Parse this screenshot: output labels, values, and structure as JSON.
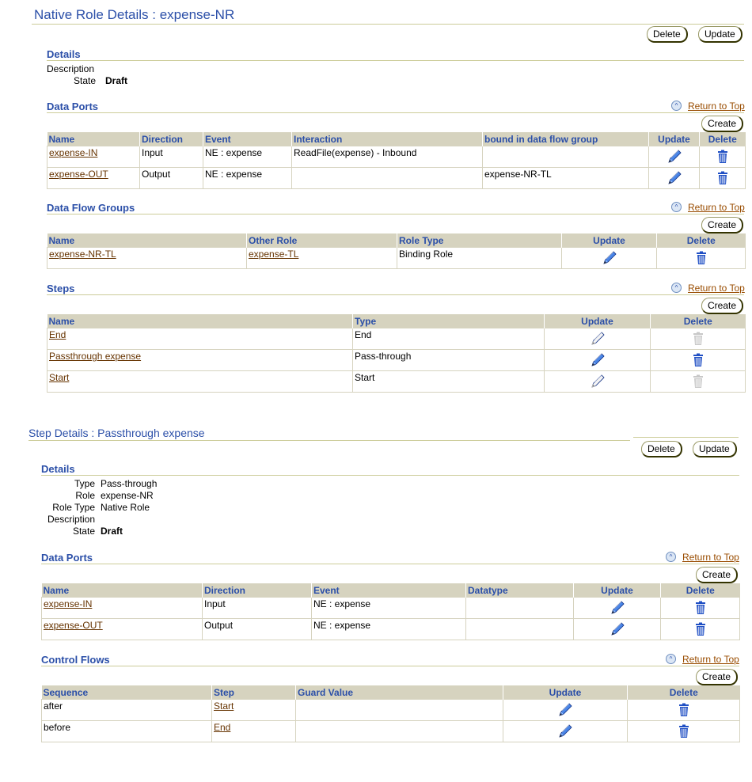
{
  "role": {
    "title": "Native Role Details : expense-NR",
    "buttons": {
      "delete": "Delete",
      "update": "Update"
    },
    "details": {
      "heading": "Details",
      "fields": [
        {
          "label": "Description",
          "value": ""
        },
        {
          "label": "State",
          "value": "Draft"
        }
      ]
    },
    "data_ports": {
      "heading": "Data Ports",
      "return_to_top": "Return to Top",
      "create": "Create",
      "columns": [
        "Name",
        "Direction",
        "Event",
        "Interaction",
        "bound in data flow group",
        "Update",
        "Delete"
      ],
      "rows": [
        {
          "name": "expense-IN",
          "direction": "Input",
          "event": "NE : expense",
          "interaction": "ReadFile(expense) - Inbound",
          "bound": "",
          "enabled": true
        },
        {
          "name": "expense-OUT",
          "direction": "Output",
          "event": "NE : expense",
          "interaction": "",
          "bound": "expense-NR-TL",
          "enabled": true
        }
      ]
    },
    "data_flow_groups": {
      "heading": "Data Flow Groups",
      "return_to_top": "Return to Top",
      "create": "Create",
      "columns": [
        "Name",
        "Other Role",
        "Role Type",
        "Update",
        "Delete"
      ],
      "rows": [
        {
          "name": "expense-NR-TL",
          "other_role": "expense-TL",
          "role_type": "Binding Role",
          "enabled": true
        }
      ]
    },
    "steps": {
      "heading": "Steps",
      "return_to_top": "Return to Top",
      "create": "Create",
      "columns": [
        "Name",
        "Type",
        "Update",
        "Delete"
      ],
      "rows": [
        {
          "name": "End",
          "type": "End",
          "enabled": false
        },
        {
          "name": "Passthrough expense",
          "type": "Pass-through",
          "enabled": true
        },
        {
          "name": "Start",
          "type": "Start",
          "enabled": false
        }
      ]
    }
  },
  "step": {
    "title": "Step Details : Passthrough expense",
    "buttons": {
      "delete": "Delete",
      "update": "Update"
    },
    "details": {
      "heading": "Details",
      "fields": [
        {
          "label": "Type",
          "value": "Pass-through"
        },
        {
          "label": "Role",
          "value": "expense-NR"
        },
        {
          "label": "Role Type",
          "value": "Native Role"
        },
        {
          "label": "Description",
          "value": ""
        },
        {
          "label": "State",
          "value": "Draft"
        }
      ]
    },
    "data_ports": {
      "heading": "Data Ports",
      "return_to_top": "Return to Top",
      "create": "Create",
      "columns": [
        "Name",
        "Direction",
        "Event",
        "Datatype",
        "Update",
        "Delete"
      ],
      "rows": [
        {
          "name": "expense-IN",
          "direction": "Input",
          "event": "NE : expense",
          "datatype": "",
          "enabled": true
        },
        {
          "name": "expense-OUT",
          "direction": "Output",
          "event": "NE : expense",
          "datatype": "",
          "enabled": true
        }
      ]
    },
    "control_flows": {
      "heading": "Control Flows",
      "return_to_top": "Return to Top",
      "create": "Create",
      "columns": [
        "Sequence",
        "Step",
        "Guard Value",
        "Update",
        "Delete"
      ],
      "rows": [
        {
          "sequence": "after",
          "step": "Start",
          "guard": "",
          "enabled": true
        },
        {
          "sequence": "before",
          "step": "End",
          "guard": "",
          "enabled": true
        }
      ]
    }
  },
  "colors": {
    "heading": "#2b4fa8",
    "table_header_bg": "#d6d3bf",
    "link": "#663300",
    "rule": "#cccc99",
    "icon_active": "#1f4fc4",
    "icon_disabled": "#bdbdbd"
  }
}
